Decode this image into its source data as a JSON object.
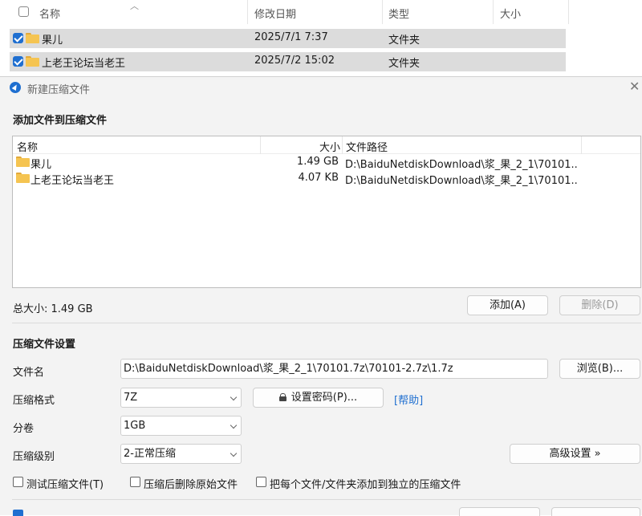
{
  "explorer": {
    "columns": {
      "name": "名称",
      "date": "修改日期",
      "type": "类型",
      "size": "大小"
    },
    "rows": [
      {
        "name": "果儿",
        "date": "2025/7/1 7:37",
        "type": "文件夹"
      },
      {
        "name": "上老王论坛当老王",
        "date": "2025/7/2 15:02",
        "type": "文件夹"
      }
    ]
  },
  "dialog": {
    "title": "新建压缩文件",
    "add_section_title": "添加文件到压缩文件",
    "file_list": {
      "columns": {
        "name": "名称",
        "size": "大小",
        "path": "文件路径"
      },
      "rows": [
        {
          "name": "果儿",
          "size": "1.49 GB",
          "path": "D:\\BaiduNetdiskDownload\\浆_果_2_1\\70101...."
        },
        {
          "name": "上老王论坛当老王",
          "size": "4.07 KB",
          "path": "D:\\BaiduNetdiskDownload\\浆_果_2_1\\70101...."
        }
      ]
    },
    "total_size": "总大小: 1.49 GB",
    "add_button": "添加(A)",
    "delete_button": "删除(D)",
    "settings_title": "压缩文件设置",
    "filename_label": "文件名",
    "filename_value": "D:\\BaiduNetdiskDownload\\浆_果_2_1\\70101.7z\\70101-2.7z\\1.7z",
    "browse_button": "浏览(B)...",
    "format_label": "压缩格式",
    "format_value": "7Z",
    "set_password_button": "设置密码(P)...",
    "help_link": "[帮助]",
    "volume_label": "分卷",
    "volume_value": "1GB",
    "level_label": "压缩级别",
    "level_value": "2-正常压缩",
    "advanced_button": "高级设置 »",
    "options": {
      "test": "测试压缩文件(T)",
      "delete_after": "压缩后删除原始文件",
      "separate": "把每个文件/文件夹添加到独立的压缩文件"
    }
  },
  "colors": {
    "accent": "#1f6fd0",
    "selected_row": "#dcdcdc",
    "folder": "#f5c451"
  }
}
